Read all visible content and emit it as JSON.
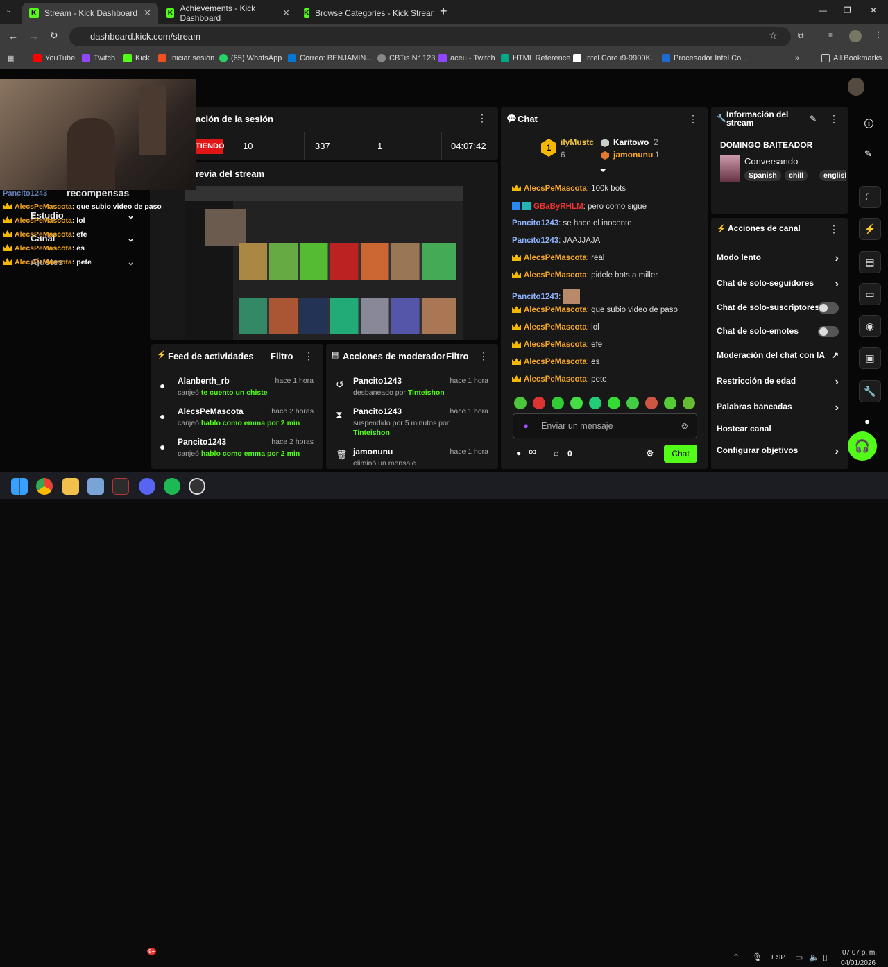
{
  "browser": {
    "tabs": [
      {
        "title": "Stream - Kick Dashboard",
        "active": true
      },
      {
        "title": "Achievements - Kick Dashboard"
      },
      {
        "title": "Browse Categories - Kick Stream"
      }
    ],
    "url": "dashboard.kick.com/stream",
    "bookmarks": [
      "YouTube",
      "Twitch",
      "Kick",
      "Iniciar sesión",
      "(65) WhatsApp",
      "Correo: BENJAMIN...",
      "CBTis N° 123",
      "aceu - Twitch",
      "HTML Reference",
      "Intel Core i9-9900K...",
      "Procesador Intel Co...",
      "All Bookmarks"
    ]
  },
  "session": {
    "title": "ación de la sesión",
    "status": "TIENDO",
    "viewers": "10",
    "followers": "337",
    "subs": "1",
    "duration": "04:07:42"
  },
  "preview": {
    "title": "revia del stream"
  },
  "overlay": {
    "rewards": "recompensas",
    "estudio": "Estudio",
    "canal": "Canal",
    "ajustes": "Ajustes",
    "partial_user": "Pancito1243",
    "lines": [
      {
        "user": "AlecsPeMascota",
        "msg": ": que subio video de paso"
      },
      {
        "user": "AlecsPeMascota",
        "msg": ": lol"
      },
      {
        "user": "AlecsPeMascota",
        "msg": ": efe"
      },
      {
        "user": "AlecsPeMascota",
        "msg": ": es"
      },
      {
        "user": "AlecsPeMascota",
        "msg": ": pete"
      }
    ]
  },
  "feed": {
    "title": "Feed de actividades",
    "filter": "Filtro",
    "items": [
      {
        "user": "Alanberth_rb",
        "time": "hace 1 hora",
        "action": "canjeó",
        "reward": "te cuento un chiste"
      },
      {
        "user": "AlecsPeMascota",
        "time": "hace 2 horas",
        "action": "canjeó",
        "reward": "hablo como emma por 2 min"
      },
      {
        "user": "Pancito1243",
        "time": "hace 2 horas",
        "action": "canjeó",
        "reward": "hablo como emma por 2 min"
      }
    ]
  },
  "mod": {
    "title": "Acciones de moderador",
    "filter": "Filtro",
    "items": [
      {
        "user": "Pancito1243",
        "time": "hace 1 hora",
        "line1": "desbaneado por",
        "by": "Tinteishon"
      },
      {
        "user": "Pancito1243",
        "time": "hace 1 hora",
        "line1": "suspendido por 5 minutos por",
        "by": "Tinteishon"
      },
      {
        "user": "jamonunu",
        "time": "hace 1 hora",
        "line1": "eliminó un mensaje",
        "by": ""
      }
    ]
  },
  "chat": {
    "title": "Chat",
    "leaders": [
      {
        "rank": "1",
        "name": "ilyMustc",
        "count": "6"
      },
      {
        "rank": "",
        "name": "Karitowo",
        "count": "2"
      },
      {
        "rank": "3",
        "name": "jamonunu",
        "count": "1"
      }
    ],
    "messages": [
      {
        "user": "AlecsPeMascota",
        "msg": "100k bots",
        "style": "o"
      },
      {
        "user": "GBaByRHLM",
        "msg": "pero como sigue",
        "style": "r"
      },
      {
        "user": "Pancito1243",
        "msg": "se hace el inocente",
        "style": "b"
      },
      {
        "user": "Pancito1243",
        "msg": "JAAJJAJA",
        "style": "b"
      },
      {
        "user": "AlecsPeMascota",
        "msg": "real",
        "style": "o"
      },
      {
        "user": "AlecsPeMascota",
        "msg": "pidele bots a miller",
        "style": "o"
      },
      {
        "user": "Pancito1243",
        "msg": "",
        "style": "b"
      },
      {
        "user": "AlecsPeMascota",
        "msg": "que subio video de paso",
        "style": "o"
      },
      {
        "user": "AlecsPeMascota",
        "msg": "lol",
        "style": "o"
      },
      {
        "user": "AlecsPeMascota",
        "msg": "efe",
        "style": "o"
      },
      {
        "user": "AlecsPeMascota",
        "msg": "es",
        "style": "o"
      },
      {
        "user": "AlecsPeMascota",
        "msg": "pete",
        "style": "o"
      }
    ],
    "placeholder": "Enviar un mensaje",
    "points": "0",
    "send": "Chat",
    "infinity": "∞"
  },
  "info": {
    "title": "Información del stream",
    "stream_title": "DOMINGO BAITEADOR",
    "category": "Conversando",
    "tags": [
      "Spanish",
      "chill",
      "english"
    ]
  },
  "actions": {
    "title": "Acciones de canal",
    "items": [
      "Modo lento",
      "Chat de solo-seguidores",
      "Chat de solo-suscriptores",
      "Chat de solo-emotes",
      "Moderación del chat con IA",
      "Restricción de edad",
      "Palabras baneadas",
      "Hostear canal",
      "Configurar objetivos"
    ]
  },
  "taskbar": {
    "lang": "ESP",
    "time": "07:07 p. m.",
    "date": "04/01/2026",
    "badge": "9+"
  },
  "colors": {
    "kick_green": "#53fc18",
    "orange_user": "#f5a623",
    "blue_user": "#8fb4ff"
  }
}
